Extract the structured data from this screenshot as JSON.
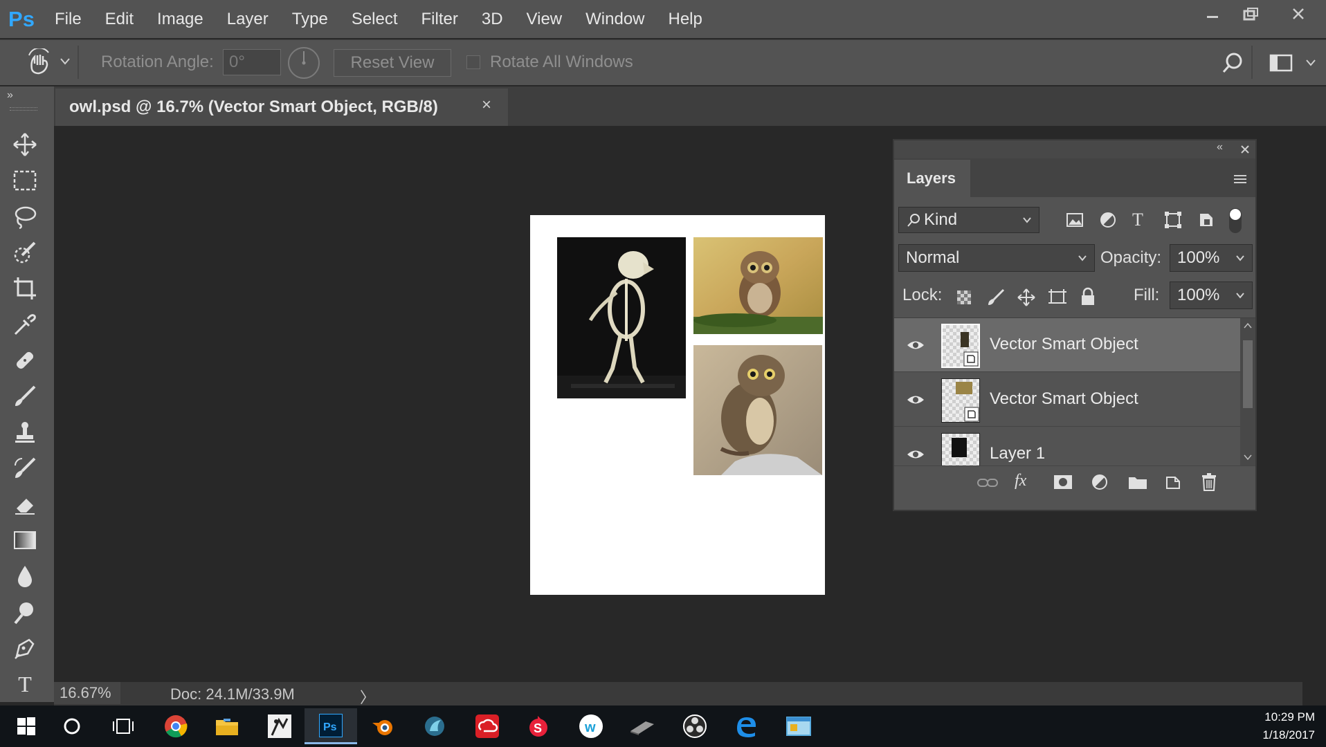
{
  "app": {
    "logo": "Ps"
  },
  "menu": {
    "items": [
      "File",
      "Edit",
      "Image",
      "Layer",
      "Type",
      "Select",
      "Filter",
      "3D",
      "View",
      "Window",
      "Help"
    ]
  },
  "window_controls": [
    "minimize-icon",
    "restore-icon",
    "close-icon"
  ],
  "options": {
    "rotation_label": "Rotation Angle:",
    "rotation_value": "0°",
    "reset_view": "Reset View",
    "rotate_all": "Rotate All Windows",
    "rotate_all_checked": false
  },
  "document": {
    "tab_title": "owl.psd @ 16.7% (Vector Smart Object, RGB/8)",
    "tab_close": "×"
  },
  "tools": [
    "move-tool",
    "marquee-tool",
    "lasso-tool",
    "quick-selection-tool",
    "crop-tool",
    "eyedropper-tool",
    "healing-brush-tool",
    "brush-tool",
    "clone-stamp-tool",
    "history-brush-tool",
    "eraser-tool",
    "gradient-tool",
    "blur-tool",
    "dodge-tool",
    "pen-tool",
    "type-tool"
  ],
  "status": {
    "zoom": "16.67%",
    "doc": "Doc: 24.1M/33.9M",
    "arrow": "〉"
  },
  "layers_panel": {
    "title": "Layers",
    "filter_kind": "Kind",
    "blend_mode": "Normal",
    "opacity_label": "Opacity:",
    "opacity_value": "100%",
    "lock_label": "Lock:",
    "fill_label": "Fill:",
    "fill_value": "100%",
    "layers": [
      {
        "name": "Vector Smart Object",
        "visible": true,
        "selected": true,
        "thumb": "skeleton"
      },
      {
        "name": "Vector Smart Object",
        "visible": true,
        "selected": false,
        "thumb": "owl"
      },
      {
        "name": "Layer 1",
        "visible": true,
        "selected": false,
        "thumb": "skeleton"
      }
    ]
  },
  "taskbar": {
    "apps": [
      "windows-start",
      "cortana",
      "task-view",
      "chrome",
      "file-explorer",
      "zbrush",
      "photoshop",
      "blender",
      "app-circle",
      "creative-cloud",
      "substance",
      "wacom",
      "tablet-app",
      "obs",
      "edge",
      "app-window"
    ],
    "active": "photoshop",
    "time": "10:29 PM",
    "date": "1/18/2017"
  },
  "colors": {
    "ps_blue": "#31a8ff",
    "chrome_bg": "#535353",
    "canvas_bg": "#282828"
  }
}
